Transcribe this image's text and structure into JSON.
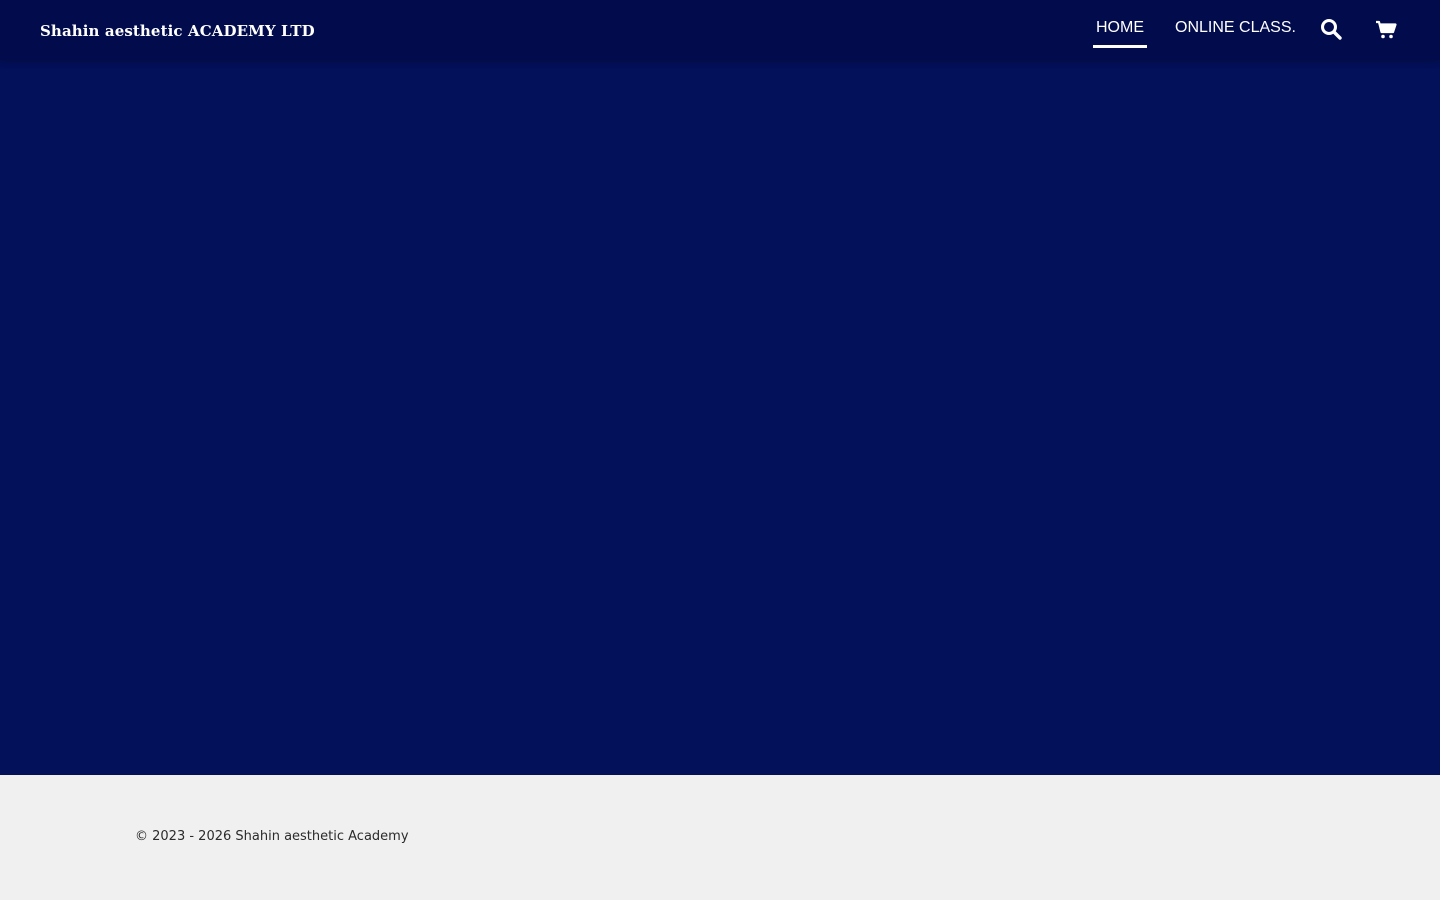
{
  "header": {
    "brand": "Shahin aesthetic ACADEMY LTD",
    "nav": [
      {
        "label": "HOME",
        "active": true
      },
      {
        "label": "ONLINE CLASS.",
        "active": false
      }
    ],
    "icons": [
      "search-icon",
      "cart-icon"
    ]
  },
  "hero": {
    "background_color": "#03105a"
  },
  "footer": {
    "copyright": "© 2023 - 2026 Shahin aesthetic Academy",
    "background_color": "#f0f0f0"
  },
  "colors": {
    "header_bg": "#020c4c",
    "text_light": "#ffffff"
  }
}
